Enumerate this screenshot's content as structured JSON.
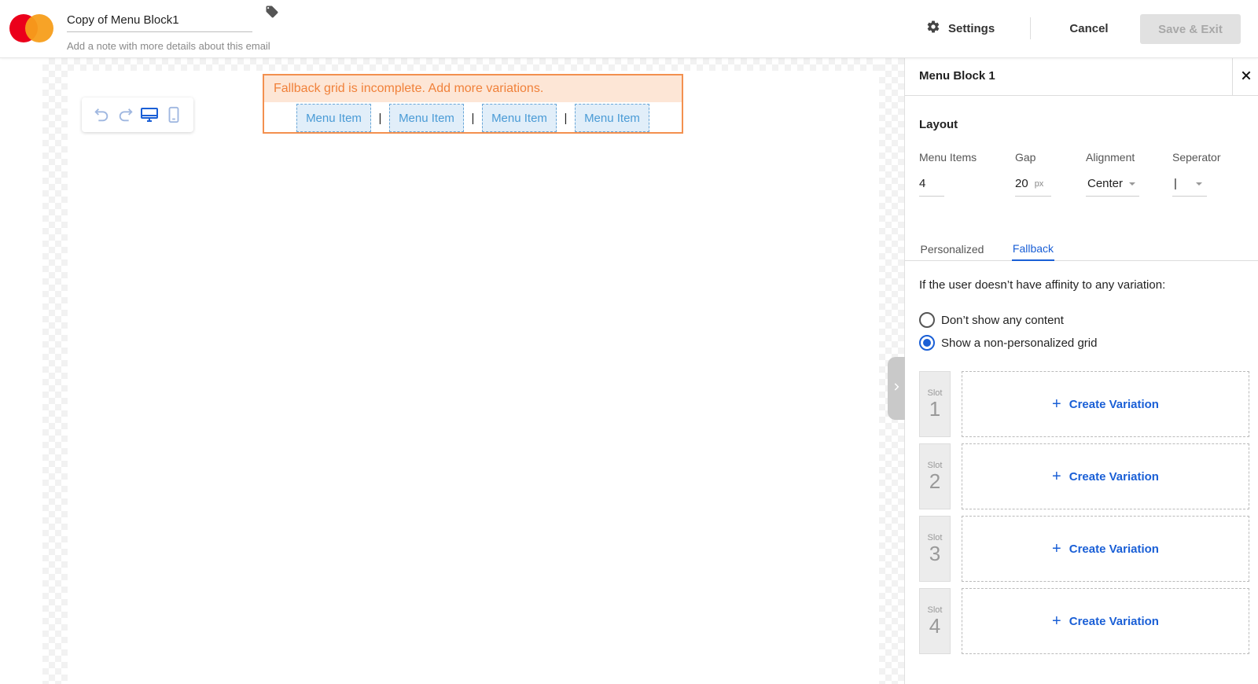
{
  "header": {
    "title_value": "Copy of Menu Block1",
    "note_placeholder": "Add a note with more details about this email",
    "settings_label": "Settings",
    "cancel_label": "Cancel",
    "save_label": "Save & Exit"
  },
  "canvas": {
    "warning": "Fallback grid is incomplete. Add more variations.",
    "menu_items": [
      "Menu Item",
      "Menu Item",
      "Menu Item",
      "Menu Item"
    ],
    "separator": "|"
  },
  "panel": {
    "title": "Menu Block 1",
    "layout_title": "Layout",
    "fields": {
      "menu_items": {
        "label": "Menu Items",
        "value": "4"
      },
      "gap": {
        "label": "Gap",
        "value": "20",
        "unit": "px"
      },
      "alignment": {
        "label": "Alignment",
        "value": "Center"
      },
      "separator": {
        "label": "Seperator",
        "value": "|"
      }
    },
    "tabs": [
      {
        "label": "Personalized",
        "active": false
      },
      {
        "label": "Fallback",
        "active": true
      }
    ],
    "affinity_text": "If the user doesn’t have affinity to any variation:",
    "radio_options": [
      {
        "label": "Don’t show any content",
        "checked": false
      },
      {
        "label": "Show a non-personalized grid",
        "checked": true
      }
    ],
    "slots": [
      {
        "label": "Slot",
        "number": "1",
        "action": "Create Variation"
      },
      {
        "label": "Slot",
        "number": "2",
        "action": "Create Variation"
      },
      {
        "label": "Slot",
        "number": "3",
        "action": "Create Variation"
      },
      {
        "label": "Slot",
        "number": "4",
        "action": "Create Variation"
      }
    ]
  },
  "colors": {
    "accent": "#1a5fd6",
    "warning_text": "#f0813a",
    "warning_border": "#f3904f",
    "menu_item_bg": "#e1eef9"
  }
}
